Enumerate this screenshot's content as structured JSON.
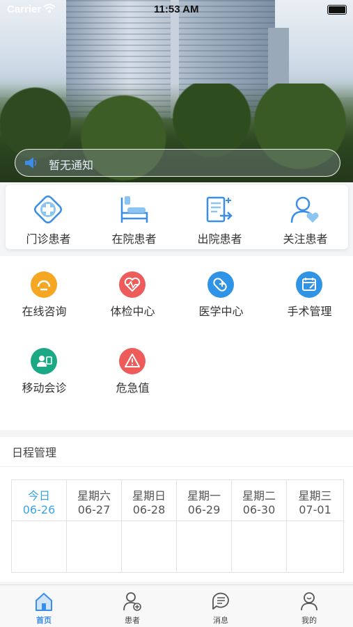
{
  "status_bar": {
    "carrier": "Carrier",
    "time": "11:53 AM"
  },
  "notice": {
    "text": "暂无通知",
    "icon": "speaker-icon"
  },
  "quick_entries": [
    {
      "label": "门诊患者",
      "icon": "outpatient-icon"
    },
    {
      "label": "在院患者",
      "icon": "inpatient-bed-icon"
    },
    {
      "label": "出院患者",
      "icon": "discharge-icon"
    },
    {
      "label": "关注患者",
      "icon": "follow-patient-icon"
    }
  ],
  "functions": [
    {
      "label": "在线咨询",
      "icon": "consult-icon",
      "color": "#f5a623"
    },
    {
      "label": "体检中心",
      "icon": "heartbeat-icon",
      "color": "#ee5b5b"
    },
    {
      "label": "医学中心",
      "icon": "medical-kit-icon",
      "color": "#2f93e6"
    },
    {
      "label": "手术管理",
      "icon": "calendar-edit-icon",
      "color": "#2f93e6"
    },
    {
      "label": "移动会诊",
      "icon": "video-consult-icon",
      "color": "#1aa984"
    },
    {
      "label": "危急值",
      "icon": "warning-icon",
      "color": "#ee5b5b"
    }
  ],
  "schedule": {
    "title": "日程管理",
    "days": [
      {
        "name": "今日",
        "date": "06-26",
        "today": true
      },
      {
        "name": "星期六",
        "date": "06-27"
      },
      {
        "name": "星期日",
        "date": "06-28"
      },
      {
        "name": "星期一",
        "date": "06-29"
      },
      {
        "name": "星期二",
        "date": "06-30"
      },
      {
        "name": "星期三",
        "date": "07-01"
      }
    ]
  },
  "tabs": [
    {
      "label": "首页",
      "icon": "home-icon",
      "active": true
    },
    {
      "label": "患者",
      "icon": "patient-icon"
    },
    {
      "label": "消息",
      "icon": "message-icon"
    },
    {
      "label": "我的",
      "icon": "profile-icon"
    }
  ],
  "colors": {
    "accent": "#3a8de8",
    "today": "#3aa3e3"
  }
}
